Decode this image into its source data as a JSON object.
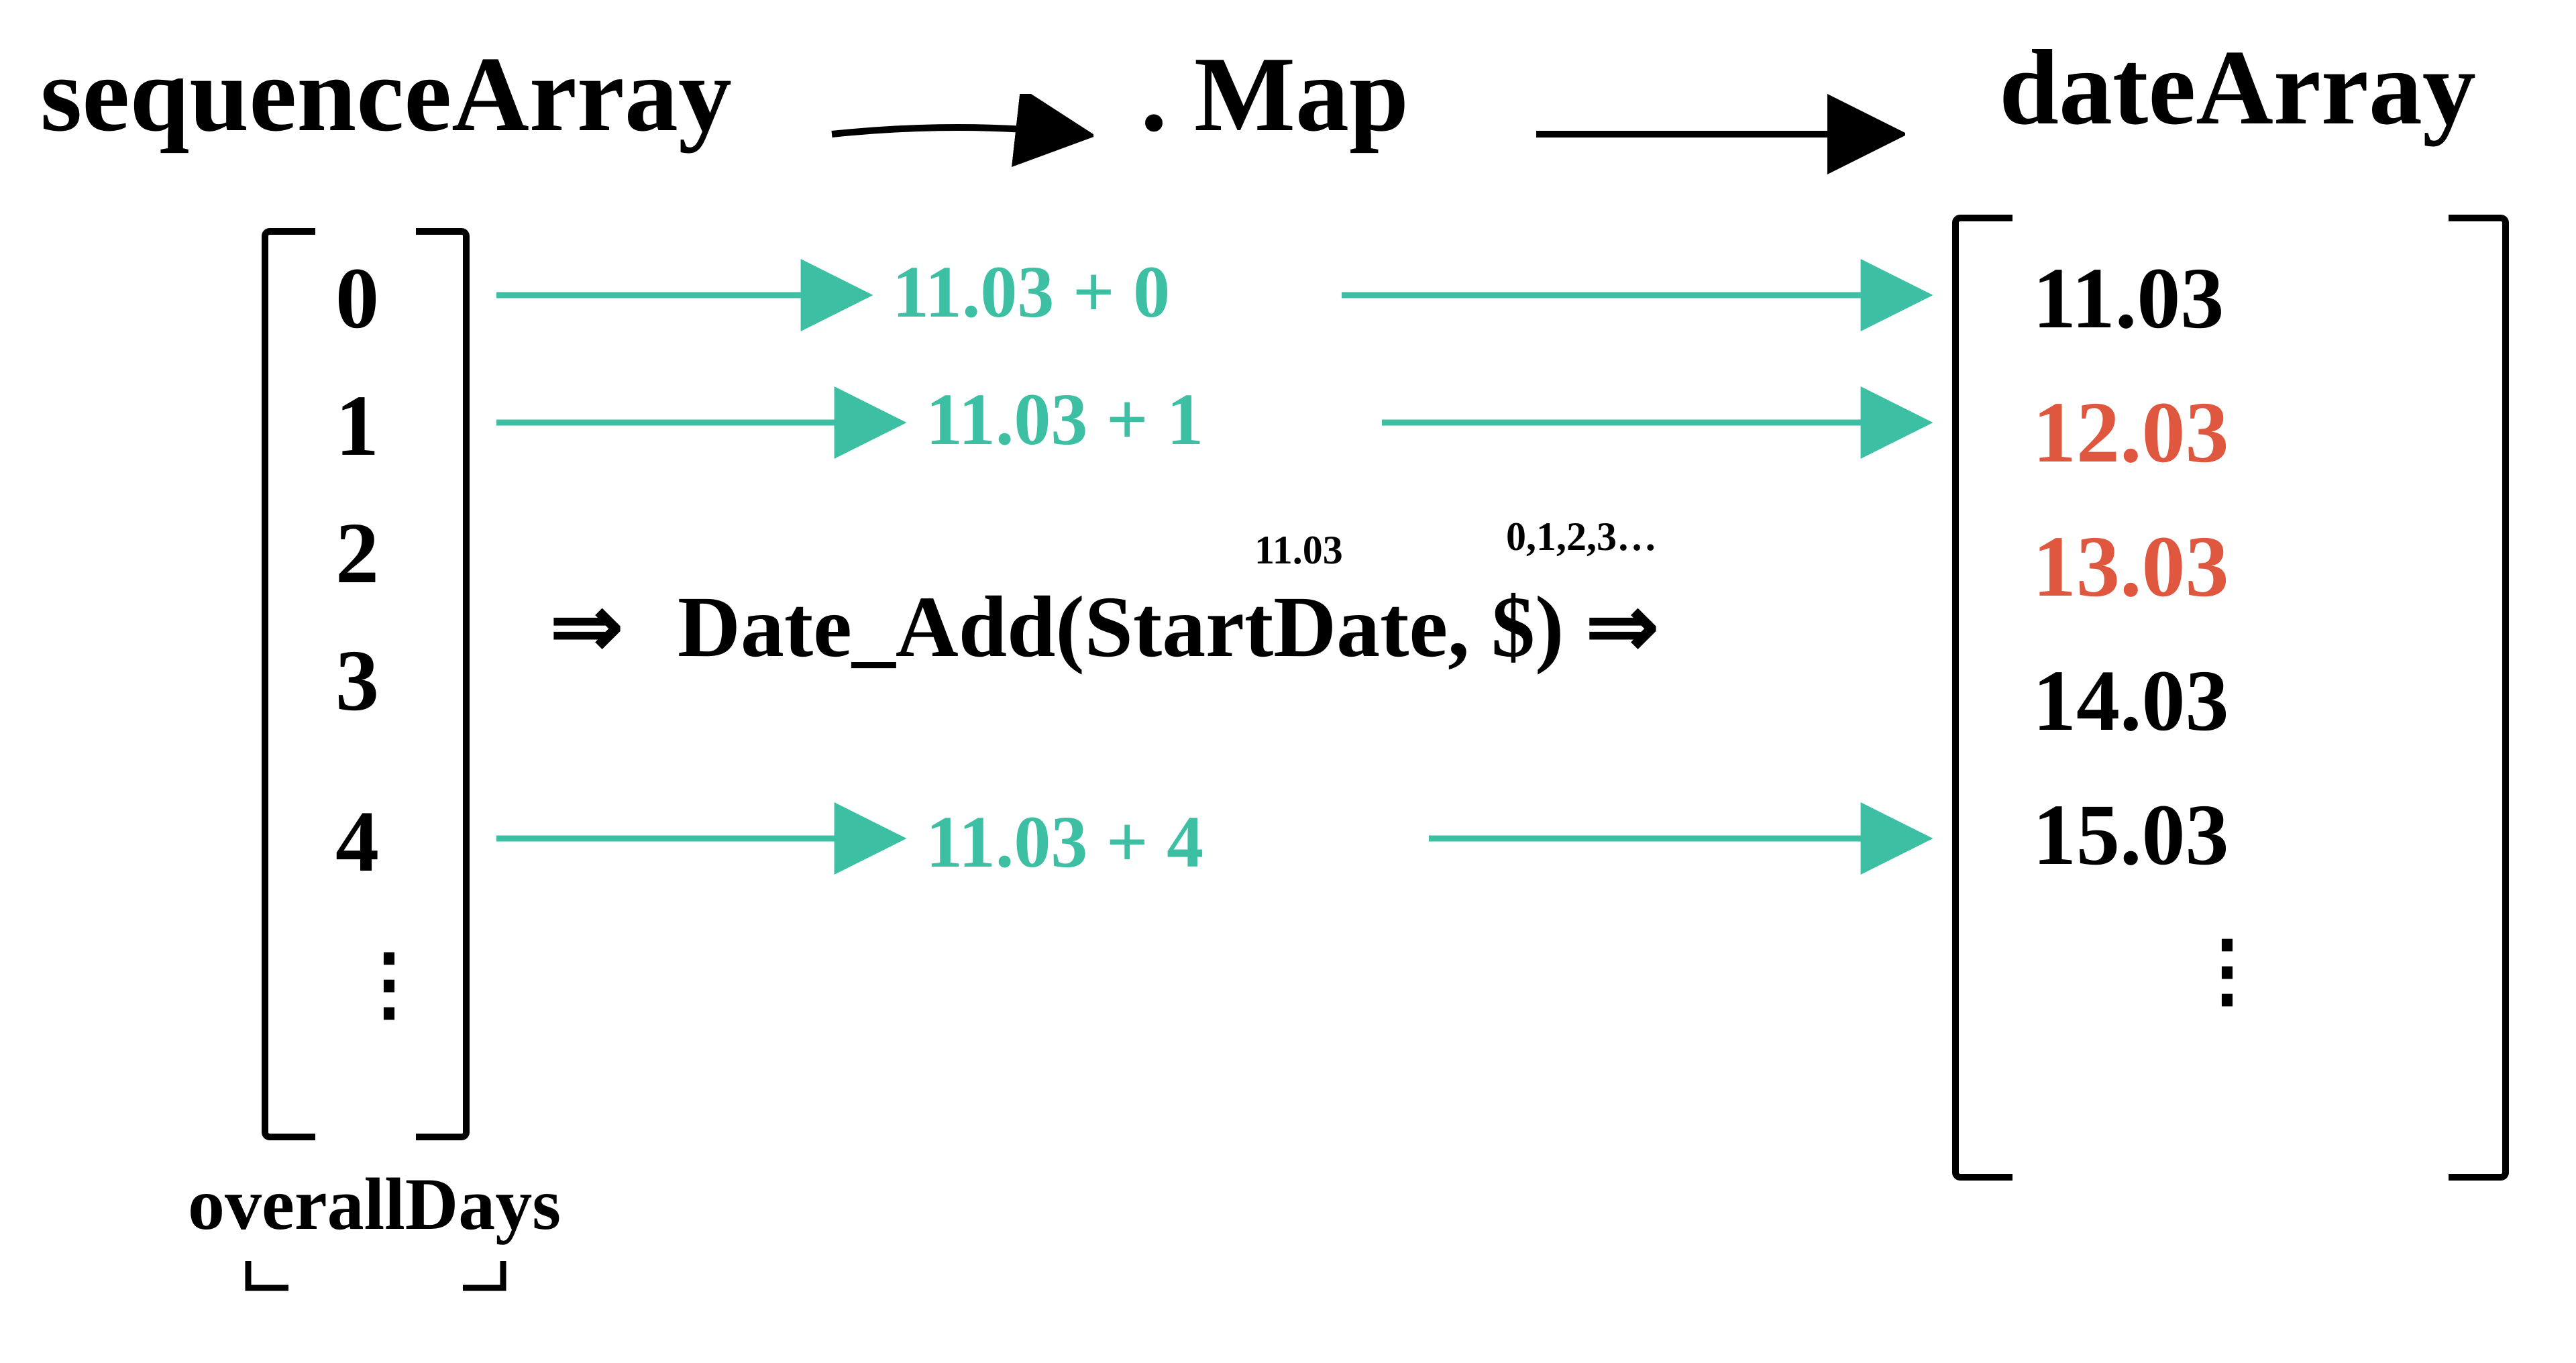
{
  "titles": {
    "sequenceArray": "sequenceArray",
    "map": ". Map",
    "dateArray": "dateArray"
  },
  "sequenceArray": {
    "values": [
      "0",
      "1",
      "2",
      "3",
      "4"
    ],
    "ellipsis": "⋮",
    "caption": "overallDays"
  },
  "mapExpressions": {
    "row0": "11.03 + 0",
    "row1": "11.03 + 1",
    "row4": "11.03 + 4"
  },
  "formula": {
    "leading": "⇒",
    "text": "Date_Add(StartDate, $) ⇒",
    "startDateNote": "11.03",
    "indexNote": "0,1,2,3…"
  },
  "dateArray": {
    "values": [
      {
        "text": "11.03",
        "highlight": false
      },
      {
        "text": "12.03",
        "highlight": true
      },
      {
        "text": "13.03",
        "highlight": true
      },
      {
        "text": "14.03",
        "highlight": false
      },
      {
        "text": "15.03",
        "highlight": false
      }
    ],
    "ellipsis": "⋮"
  },
  "colors": {
    "ink": "#000000",
    "teal": "#3cbfa3",
    "red": "#e0573f",
    "background": "#ffffff"
  }
}
